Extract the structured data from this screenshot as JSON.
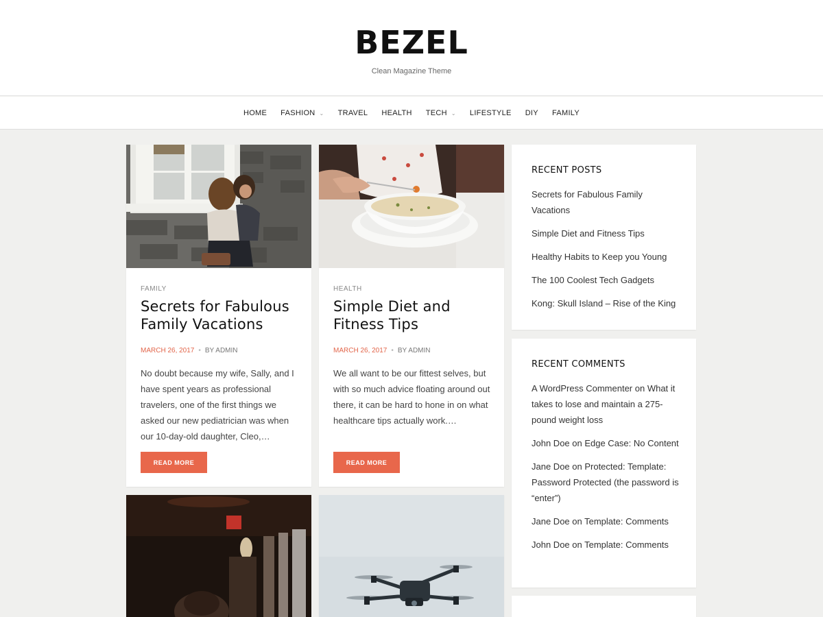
{
  "site": {
    "title": "BEZEL",
    "tagline": "Clean Magazine Theme"
  },
  "nav": {
    "items": [
      {
        "label": "HOME",
        "has_dropdown": false
      },
      {
        "label": "FASHION",
        "has_dropdown": true
      },
      {
        "label": "TRAVEL",
        "has_dropdown": false
      },
      {
        "label": "HEALTH",
        "has_dropdown": false
      },
      {
        "label": "TECH",
        "has_dropdown": true
      },
      {
        "label": "LIFESTYLE",
        "has_dropdown": false
      },
      {
        "label": "DIY",
        "has_dropdown": false
      },
      {
        "label": "FAMILY",
        "has_dropdown": false
      }
    ]
  },
  "posts": [
    {
      "category": "FAMILY",
      "title": "Secrets for Fabulous Family Vacations",
      "date": "MARCH 26, 2017",
      "author": "BY ADMIN",
      "excerpt": "No doubt because my wife, Sally, and I have spent years as professional travelers, one of the first things we asked our new pediatrician was when our 10-day-old daughter, Cleo,…",
      "read_more": "READ MORE",
      "image": "mother-and-child-photo"
    },
    {
      "category": "HEALTH",
      "title": "Simple Diet and Fitness Tips",
      "date": "MARCH 26, 2017",
      "author": "BY ADMIN",
      "excerpt": "We all want to be our fittest selves, but with so much advice floating around out there, it can be hard to hone in on what healthcare tips actually work.…",
      "read_more": "READ MORE",
      "image": "soup-bowl-photo"
    },
    {
      "image": "dark-cafe-photo"
    },
    {
      "image": "drone-photo"
    }
  ],
  "sidebar": {
    "recent_posts": {
      "heading": "RECENT POSTS",
      "items": [
        "Secrets for Fabulous Family Vacations",
        "Simple Diet and Fitness Tips",
        "Healthy Habits to Keep you Young",
        "The 100 Coolest Tech Gadgets",
        "Kong: Skull Island – Rise of the King"
      ]
    },
    "recent_comments": {
      "heading": "RECENT COMMENTS",
      "items": [
        "A WordPress Commenter on What it takes to lose and maintain a 275-pound weight loss",
        "John Doe on Edge Case: No Content",
        "Jane Doe on Protected: Template: Password Protected (the password is “enter”)",
        "Jane Doe on Template: Comments",
        "John Doe on Template: Comments"
      ]
    }
  },
  "colors": {
    "accent": "#e8674b",
    "background": "#f0f0ee"
  }
}
